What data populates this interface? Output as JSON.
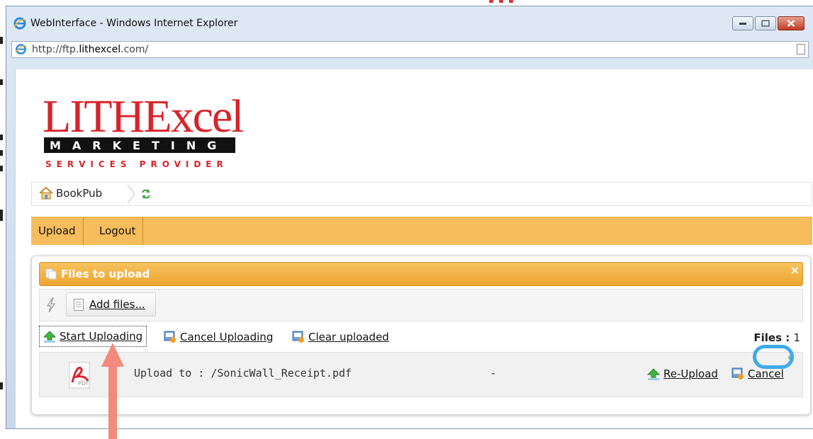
{
  "window": {
    "title": "WebInterface - Windows Internet Explorer",
    "url_prefix": "http://ftp.",
    "url_domain": "lithexcel",
    "url_suffix": ".com/"
  },
  "logo": {
    "brand": "LITHExcel",
    "line2": "MARKETING",
    "line3": "SERVICES PROVIDER",
    "color_red": "#d9232a",
    "color_black": "#111111"
  },
  "breadcrumb": {
    "home_label": "BookPub"
  },
  "menu": {
    "items": [
      {
        "label": "Upload"
      },
      {
        "label": "Logout"
      }
    ],
    "bar_color": "#f5bd5b"
  },
  "uploader": {
    "title": "Files to upload",
    "close_label": "×",
    "add_files_label": "Add files...",
    "start_label": "Start Uploading",
    "cancel_all_label": "Cancel Uploading",
    "clear_label": "Clear uploaded",
    "files_count_label": "Files :",
    "files_count": "1",
    "files": [
      {
        "icon": "pdf-icon",
        "target": "Upload to : /SonicWall_Receipt.pdf",
        "size": "-",
        "reupload_label": "Re-Upload",
        "cancel_label": "Cancel",
        "status_color": "#7cc47c"
      }
    ]
  },
  "annotations": {
    "arrow_color": "#f28b7b",
    "circle_color": "#3fa9e8"
  }
}
